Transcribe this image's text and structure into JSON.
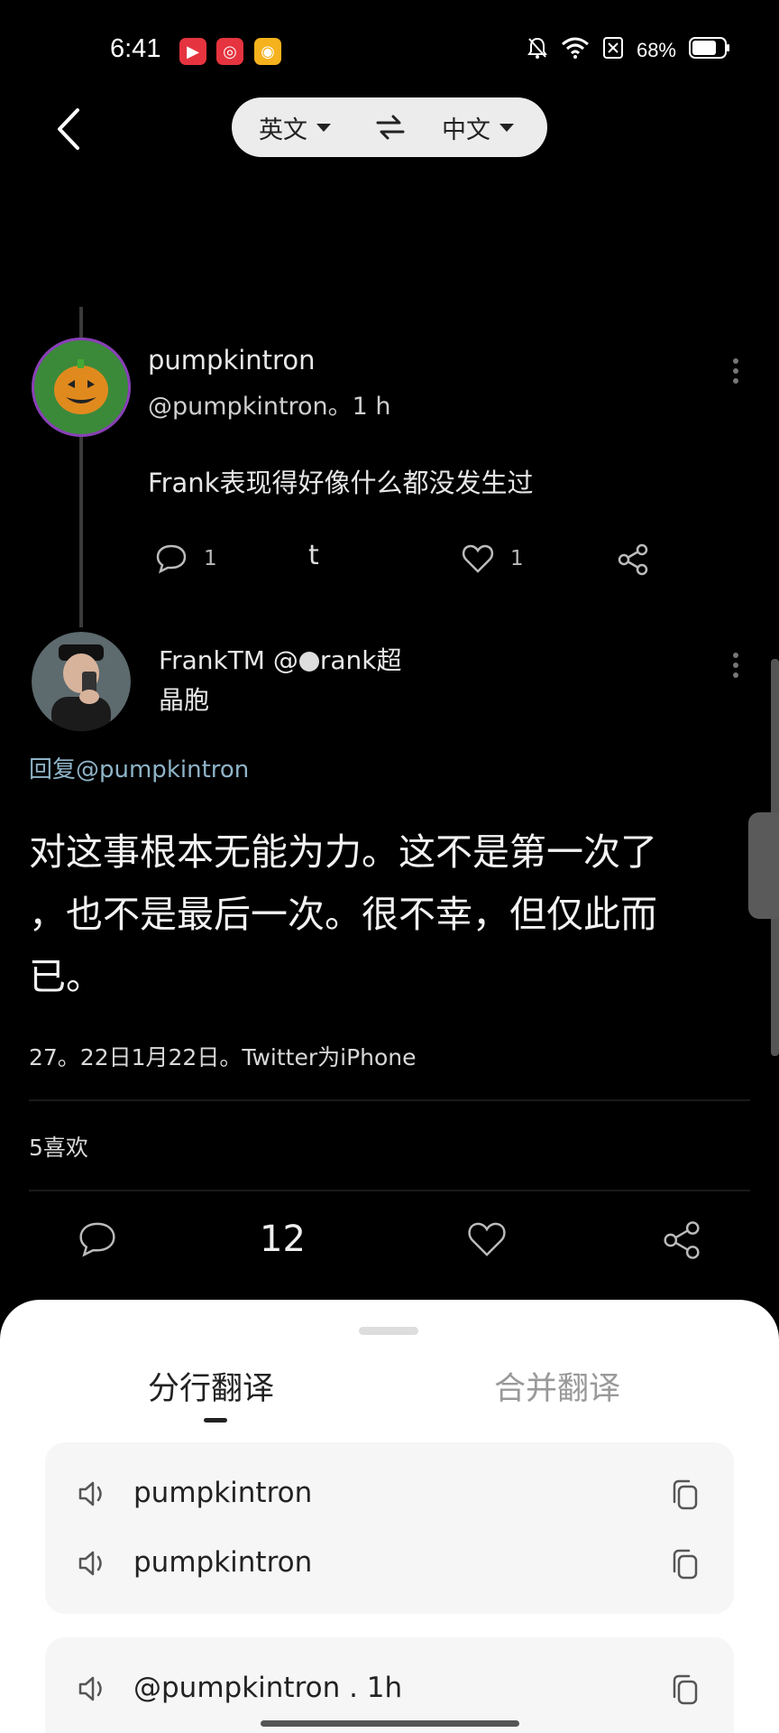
{
  "status_bar": {
    "time": "6:41",
    "battery": "68%",
    "icons": [
      "video-app-icon",
      "netease-music-icon",
      "weibo-icon",
      "bell-muted-icon",
      "wifi-icon",
      "sim-off-icon",
      "battery-icon"
    ]
  },
  "header": {
    "back_icon": "chevron-left-icon",
    "source_lang": "英文",
    "target_lang": "中文",
    "swap_icon": "swap-arrows-icon"
  },
  "tweet1": {
    "name": "pumpkintron",
    "handle": "@pumpkintron。1 h",
    "text": "Frank表现得好像什么都没发生过",
    "reply_count": "1",
    "retweet_glyph": "t",
    "like_count": "1"
  },
  "tweet2": {
    "name_line1": "FrankTM @",
    "name_line1b": "rank超",
    "name_line2": "晶胞",
    "reply_to": "回复@pumpkintron",
    "text": "对这事根本无能为力。这不是第一次了，也不是最后一次。很不幸，但仅此而已。",
    "text_lines": [
      "对这事根本无能为力。这不是第一次了",
      "，也不是最后一次。很不幸，但仅此而",
      "已。"
    ],
    "meta": "27。22日1月22日。Twitter为iPhone",
    "likes": "5喜欢",
    "action_count": "12"
  },
  "sheet": {
    "tab_active": "分行翻译",
    "tab_inactive": "合并翻译",
    "rows": [
      {
        "text": "pumpkintron"
      },
      {
        "text": "pumpkintron"
      },
      {
        "text": "@pumpkintron . 1h"
      }
    ]
  },
  "colors": {
    "background": "#000000",
    "sheet": "#ffffff",
    "accent_tab": "#222222",
    "inactive_tab": "#999999"
  }
}
